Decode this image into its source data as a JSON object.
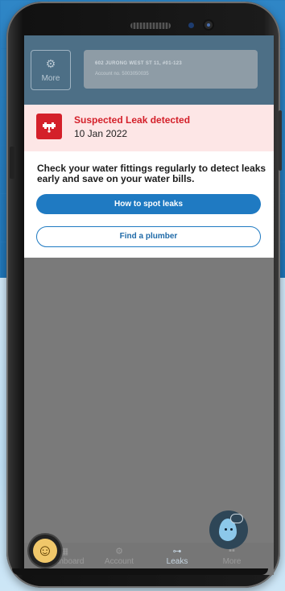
{
  "header": {
    "more_label": "More",
    "account_line1": "602 JURONG WEST ST 11, #01-123",
    "account_line2": "Account no. 5003050035"
  },
  "alert": {
    "title": "Suspected Leak detected",
    "date": "10 Jan 2022",
    "accent_color": "#d4202a",
    "icon": "pipe-icon"
  },
  "panel": {
    "message": "Check your water fittings regularly to detect leaks early and save on your water bills.",
    "primary_button": "How to spot leaks",
    "secondary_button": "Find a plumber"
  },
  "nav": {
    "items": [
      {
        "label": "Dashboard",
        "icon": "dashboard-icon"
      },
      {
        "label": "Account",
        "icon": "account-icon"
      },
      {
        "label": "Leaks",
        "icon": "leak-icon"
      },
      {
        "label": "More",
        "icon": "grid-icon"
      }
    ]
  },
  "colors": {
    "brand_blue": "#1f7ac2"
  }
}
